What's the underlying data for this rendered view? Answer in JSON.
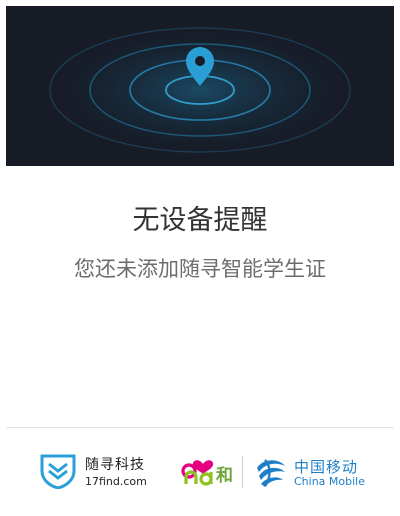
{
  "banner": {
    "icon": "location-pin-icon",
    "accent": "#2a9fd6",
    "background": "#171b26"
  },
  "empty_state": {
    "title": "无设备提醒",
    "subtitle": "您还未添加随寻智能学生证"
  },
  "footer": {
    "suixun": {
      "icon": "suixun-shield-logo-icon",
      "name": "随寻科技",
      "url": "17find.com"
    },
    "and_he": {
      "icon": "and-he-logo-icon",
      "text": "和"
    },
    "china_mobile": {
      "icon": "china-mobile-logo-icon",
      "name_cn": "中国移动",
      "name_en": "China Mobile"
    }
  }
}
